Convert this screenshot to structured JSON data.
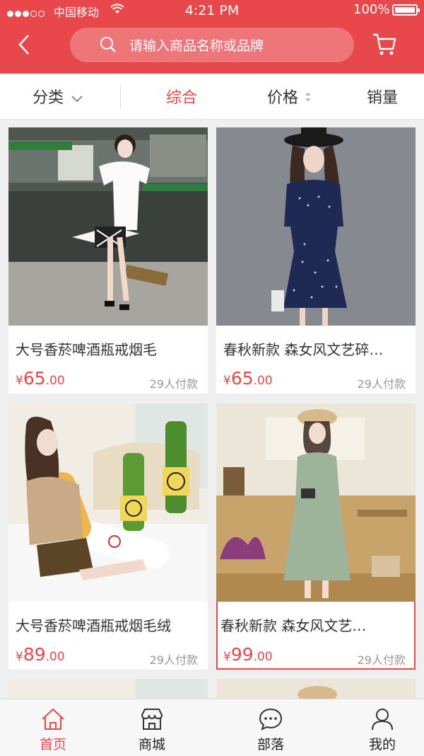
{
  "status_bar": {
    "carrier": "中国移动",
    "time": "4:21 PM",
    "battery": "100%"
  },
  "search": {
    "placeholder": "请输入商品名称或品牌"
  },
  "filters": {
    "category": "分类",
    "general": "综合",
    "price": "价格",
    "sales": "销量"
  },
  "products": [
    {
      "title": "大号香菸啤酒瓶戒烟毛",
      "price": "65",
      "cents": ".00",
      "currency": "¥",
      "sold": "29人付款"
    },
    {
      "title": "春秋新款 森女风文艺碎…",
      "price": "65",
      "cents": ".00",
      "currency": "¥",
      "sold": "29人付款"
    },
    {
      "title": "大号香菸啤酒瓶戒烟毛绒",
      "price": "89",
      "cents": ".00",
      "currency": "¥",
      "sold": "29人付款"
    },
    {
      "title": "春秋新款 森女风文艺…",
      "price": "99",
      "cents": ".00",
      "currency": "¥",
      "sold": "29人付款"
    }
  ],
  "tabs": [
    {
      "label": "首页"
    },
    {
      "label": "商城"
    },
    {
      "label": "部落"
    },
    {
      "label": "我的"
    }
  ],
  "colors": {
    "accent": "#e8484b"
  }
}
